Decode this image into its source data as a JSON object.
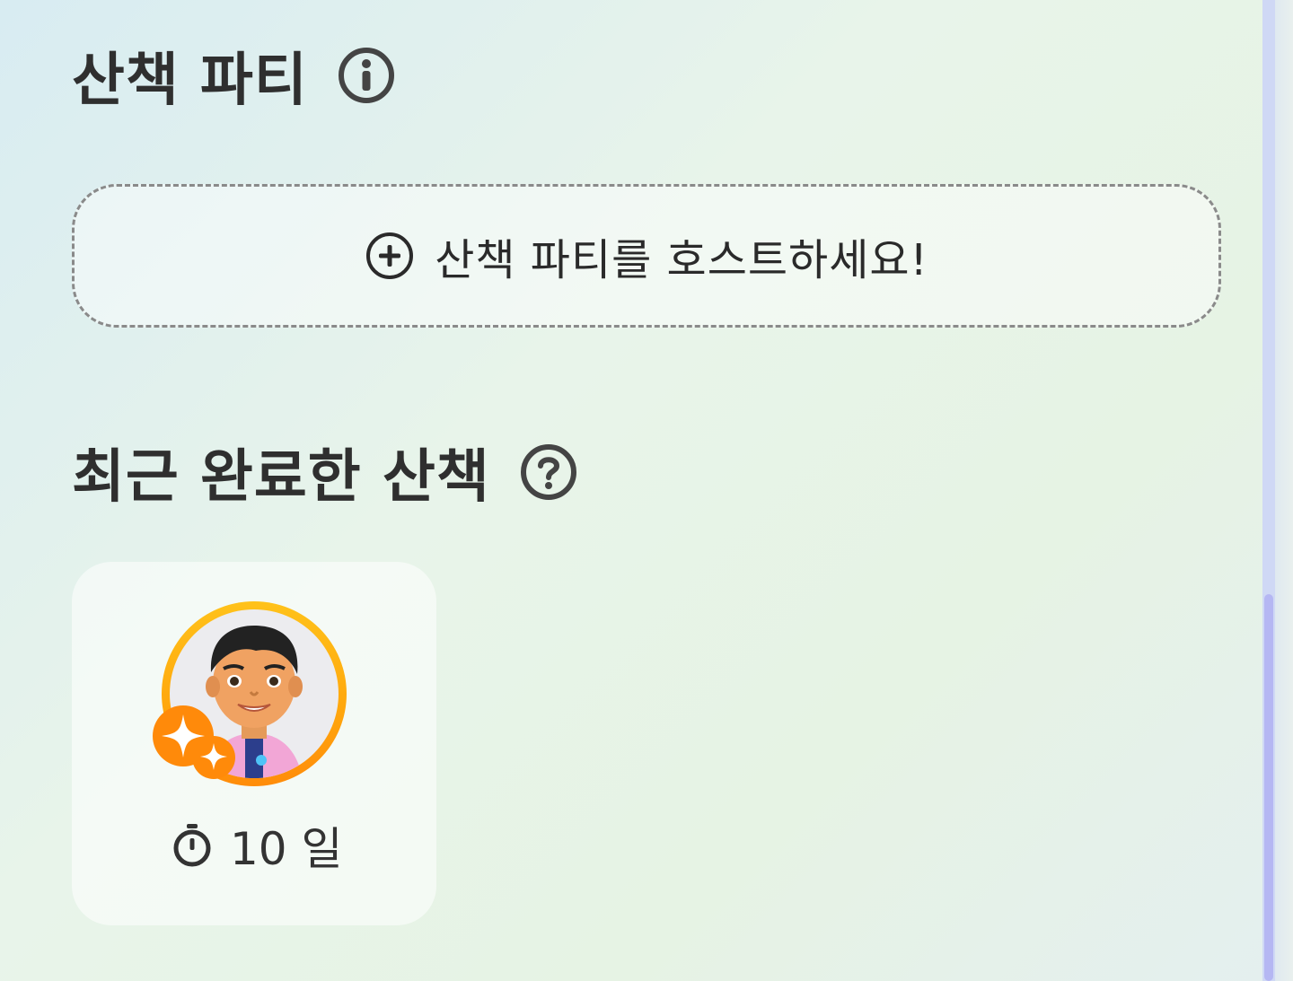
{
  "sections": {
    "walk_party": {
      "title": "산책 파티",
      "info_icon": "info-circle-icon",
      "host_button": {
        "icon": "plus-circle-icon",
        "label": "산책 파티를 호스트하세요!"
      }
    },
    "recent_walks": {
      "title": "최근 완료한 산책",
      "help_icon": "question-circle-icon",
      "items": [
        {
          "avatar": "mii-avatar",
          "badge_icon": "sparkle-icon",
          "timer_icon": "stopwatch-icon",
          "duration": "10 일"
        }
      ]
    }
  },
  "colors": {
    "ring_orange": "#ffa60d",
    "scrollbar_thumb": "#b5b7f3",
    "text_dark": "#2f2f2f"
  }
}
